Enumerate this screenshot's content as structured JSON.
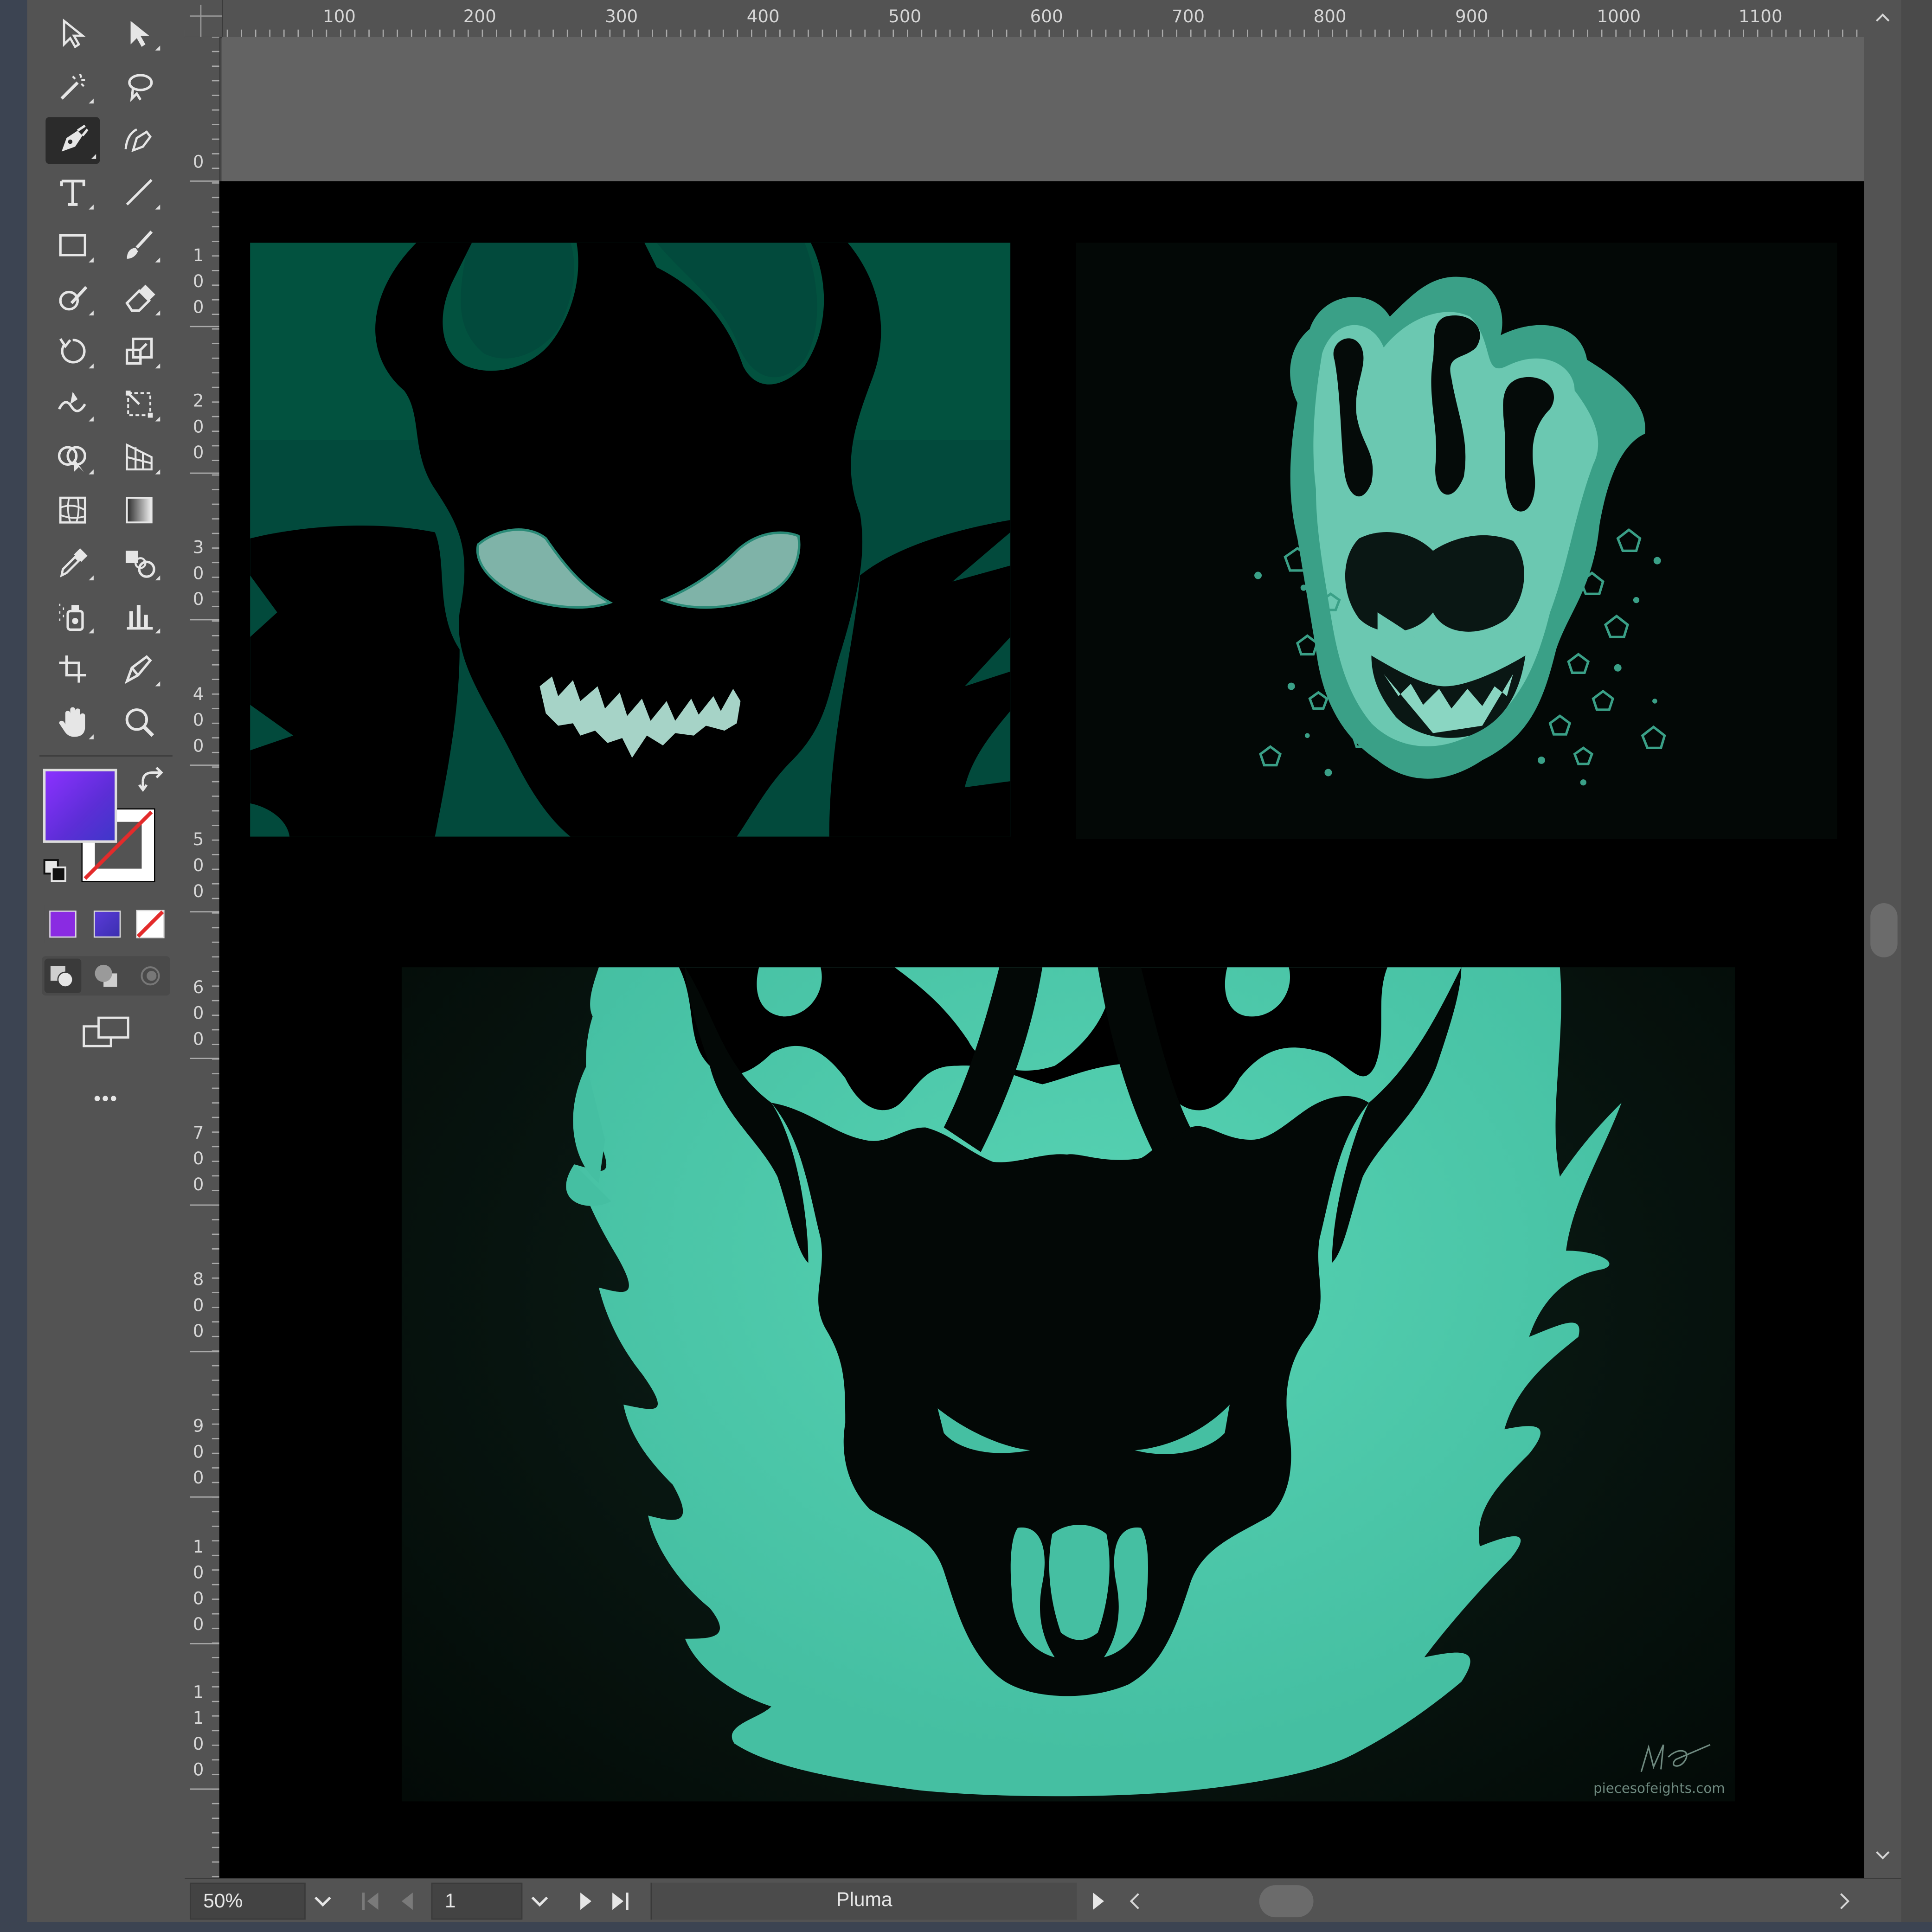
{
  "app": {
    "accent": "#7b2ff7",
    "fill_color": "#7b2ff7",
    "canvas_bg": "#000000",
    "teal": "#48c4a6"
  },
  "ruler": {
    "top_labels": [
      "100",
      "200",
      "300",
      "400",
      "500",
      "600",
      "700",
      "800",
      "900",
      "1000",
      "1100"
    ],
    "origin_label": "0",
    "left_labels": [
      "1\n0\n0",
      "2\n0\n0",
      "3\n0\n0",
      "4\n0\n0",
      "5\n0\n0",
      "6\n0\n0",
      "7\n0\n0",
      "8\n0\n0",
      "9\n0\n0",
      "1\n0\n0\n0",
      "1\n1\n0\n0"
    ]
  },
  "toolbar": {
    "tools": [
      "selection-tool-icon",
      "direct-selection-tool-icon",
      "magic-wand-tool-icon",
      "lasso-tool-icon",
      "pen-tool-icon",
      "curvature-tool-icon",
      "type-tool-icon",
      "line-segment-tool-icon",
      "rectangle-tool-icon",
      "paintbrush-tool-icon",
      "shaper-tool-icon",
      "eraser-tool-icon",
      "rotate-tool-icon",
      "scale-tool-icon",
      "warp-tool-icon",
      "free-transform-tool-icon",
      "shape-builder-tool-icon",
      "perspective-grid-tool-icon",
      "mesh-tool-icon",
      "gradient-tool-icon",
      "eyedropper-tool-icon",
      "blend-tool-icon",
      "symbol-sprayer-tool-icon",
      "column-graph-tool-icon",
      "artboard-tool-icon",
      "slice-tool-icon",
      "hand-tool-icon",
      "zoom-tool-icon"
    ],
    "more_label": "•••"
  },
  "artwork": {
    "signature": "piecesofeights.com"
  },
  "statusbar": {
    "zoom": "50%",
    "artboard_number": "1",
    "tool_name": "Pluma"
  }
}
